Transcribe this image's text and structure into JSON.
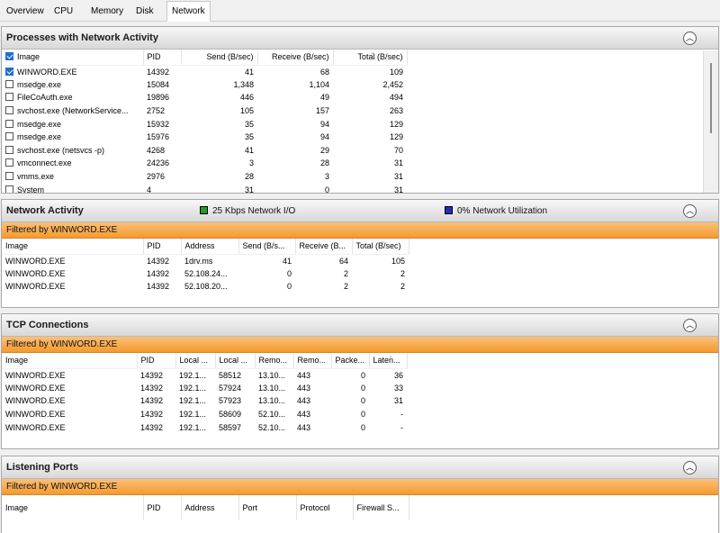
{
  "tabs": [
    "Overview",
    "CPU",
    "Memory",
    "Disk",
    "Network"
  ],
  "colors": {
    "net_io": "#1e9e2a",
    "net_util": "#1f2fbf",
    "filter_bar": "#f49a2f"
  },
  "processes": {
    "title": "Processes with Network Activity",
    "headers": [
      "Image",
      "PID",
      "Send (B/sec)",
      "Receive (B/sec)",
      "Total (B/sec)"
    ],
    "rows": [
      {
        "checked": true,
        "image": "WINWORD.EXE",
        "pid": "14392",
        "send": "41",
        "receive": "68",
        "total": "109"
      },
      {
        "checked": false,
        "image": "msedge.exe",
        "pid": "15084",
        "send": "1,348",
        "receive": "1,104",
        "total": "2,452"
      },
      {
        "checked": false,
        "image": "FileCoAuth.exe",
        "pid": "19896",
        "send": "446",
        "receive": "49",
        "total": "494"
      },
      {
        "checked": false,
        "image": "svchost.exe (NetworkService...",
        "pid": "2752",
        "send": "105",
        "receive": "157",
        "total": "263"
      },
      {
        "checked": false,
        "image": "msedge.exe",
        "pid": "15932",
        "send": "35",
        "receive": "94",
        "total": "129"
      },
      {
        "checked": false,
        "image": "msedge.exe",
        "pid": "15976",
        "send": "35",
        "receive": "94",
        "total": "129"
      },
      {
        "checked": false,
        "image": "svchost.exe (netsvcs -p)",
        "pid": "4268",
        "send": "41",
        "receive": "29",
        "total": "70"
      },
      {
        "checked": false,
        "image": "vmconnect.exe",
        "pid": "24236",
        "send": "3",
        "receive": "28",
        "total": "31"
      },
      {
        "checked": false,
        "image": "vmms.exe",
        "pid": "2976",
        "send": "28",
        "receive": "3",
        "total": "31"
      },
      {
        "checked": false,
        "image": "System",
        "pid": "4",
        "send": "31",
        "receive": "0",
        "total": "31"
      }
    ]
  },
  "network_activity": {
    "title": "Network Activity",
    "legend_io": "25 Kbps Network I/O",
    "legend_util": "0% Network Utilization",
    "filter": "Filtered by WINWORD.EXE",
    "headers": [
      "Image",
      "PID",
      "Address",
      "Send (B/s...",
      "Receive (B...",
      "Total (B/sec)"
    ],
    "rows": [
      {
        "image": "WINWORD.EXE",
        "pid": "14392",
        "address": "1drv.ms",
        "send": "41",
        "receive": "64",
        "total": "105"
      },
      {
        "image": "WINWORD.EXE",
        "pid": "14392",
        "address": "52.108.24...",
        "send": "0",
        "receive": "2",
        "total": "2"
      },
      {
        "image": "WINWORD.EXE",
        "pid": "14392",
        "address": "52.108.20...",
        "send": "0",
        "receive": "2",
        "total": "2"
      }
    ]
  },
  "tcp": {
    "title": "TCP Connections",
    "filter": "Filtered by WINWORD.EXE",
    "headers": [
      "Image",
      "PID",
      "Local ...",
      "Local ...",
      "Remo...",
      "Remo...",
      "Packe...",
      "Laten..."
    ],
    "rows": [
      {
        "image": "WINWORD.EXE",
        "pid": "14392",
        "laddr": "192.1...",
        "lport": "58512",
        "raddr": "13.10...",
        "rport": "443",
        "packets": "0",
        "latency": "36"
      },
      {
        "image": "WINWORD.EXE",
        "pid": "14392",
        "laddr": "192.1...",
        "lport": "57924",
        "raddr": "13.10...",
        "rport": "443",
        "packets": "0",
        "latency": "33"
      },
      {
        "image": "WINWORD.EXE",
        "pid": "14392",
        "laddr": "192.1...",
        "lport": "57923",
        "raddr": "13.10...",
        "rport": "443",
        "packets": "0",
        "latency": "31"
      },
      {
        "image": "WINWORD.EXE",
        "pid": "14392",
        "laddr": "192.1...",
        "lport": "58609",
        "raddr": "52.10...",
        "rport": "443",
        "packets": "0",
        "latency": "-"
      },
      {
        "image": "WINWORD.EXE",
        "pid": "14392",
        "laddr": "192.1...",
        "lport": "58597",
        "raddr": "52.10...",
        "rport": "443",
        "packets": "0",
        "latency": "-"
      }
    ]
  },
  "listening": {
    "title": "Listening Ports",
    "filter": "Filtered by WINWORD.EXE",
    "headers": [
      "Image",
      "PID",
      "Address",
      "Port",
      "Protocol",
      "Firewall S..."
    ]
  }
}
